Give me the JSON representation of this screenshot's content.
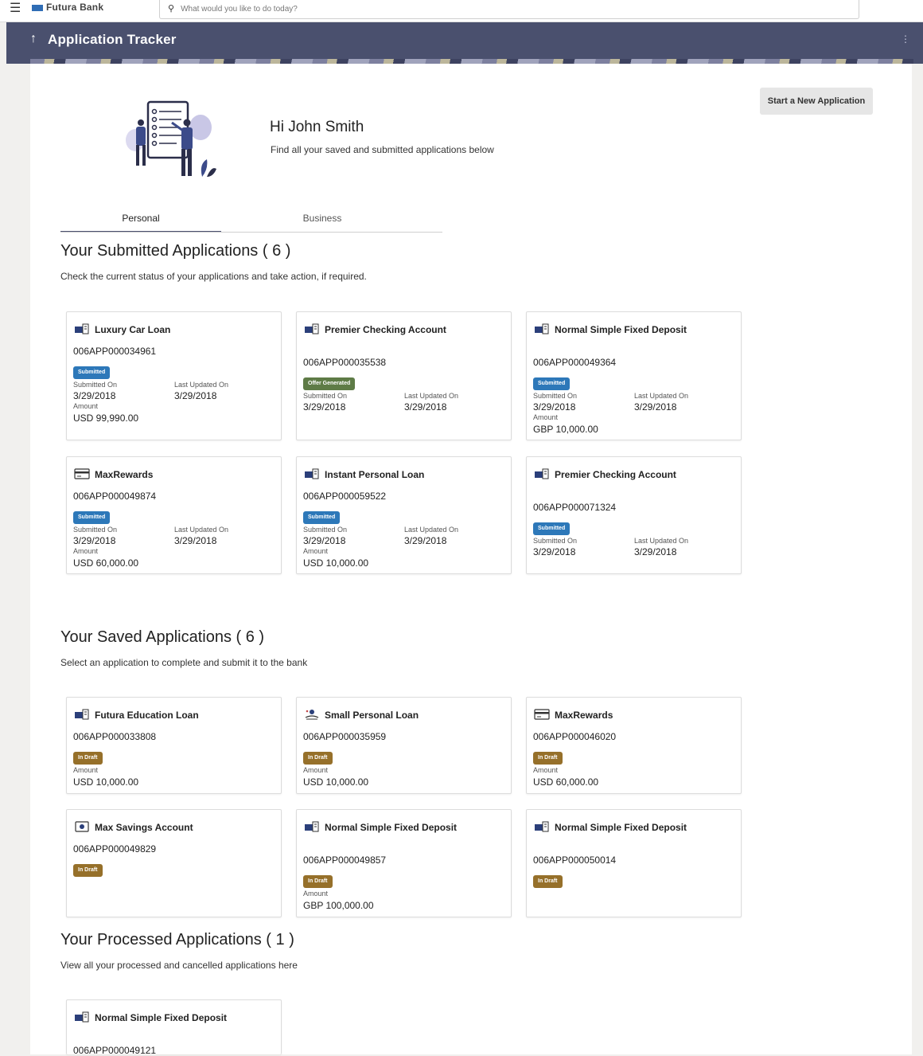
{
  "topbar": {
    "brand": "Futura Bank",
    "search_placeholder": "What would you like to do today?"
  },
  "header": {
    "title": "Application Tracker"
  },
  "actions": {
    "start_new": "Start a New Application"
  },
  "greeting": {
    "title": "Hi John Smith",
    "subtitle": "Find all your saved and submitted applications below"
  },
  "tabs": [
    {
      "label": "Personal"
    },
    {
      "label": "Business"
    }
  ],
  "submitted": {
    "title": "Your Submitted Applications ( 6 )",
    "subtitle": "Check the current status of your applications and take action, if required.",
    "cards": [
      {
        "name": "Luxury Car Loan",
        "ref": "006APP000034961",
        "status": "Submitted",
        "submitted_label": "Submitted On",
        "submitted_on": "3/29/2018",
        "updated_label": "Last Updated On",
        "updated_on": "3/29/2018",
        "amount_label": "Amount",
        "amount": "USD 99,990.00"
      },
      {
        "name": "Premier Checking Account",
        "ref": "006APP000035538",
        "status": "Offer Generated",
        "submitted_label": "Submitted On",
        "submitted_on": "3/29/2018",
        "updated_label": "Last Updated On",
        "updated_on": "3/29/2018"
      },
      {
        "name": "Normal Simple Fixed Deposit",
        "ref": "006APP000049364",
        "status": "Submitted",
        "submitted_label": "Submitted On",
        "submitted_on": "3/29/2018",
        "updated_label": "Last Updated On",
        "updated_on": "3/29/2018",
        "amount_label": "Amount",
        "amount": "GBP 10,000.00"
      },
      {
        "name": "MaxRewards",
        "ref": "006APP000049874",
        "status": "Submitted",
        "submitted_label": "Submitted On",
        "submitted_on": "3/29/2018",
        "updated_label": "Last Updated On",
        "updated_on": "3/29/2018",
        "amount_label": "Amount",
        "amount": "USD 60,000.00"
      },
      {
        "name": "Instant Personal Loan",
        "ref": "006APP000059522",
        "status": "Submitted",
        "submitted_label": "Submitted On",
        "submitted_on": "3/29/2018",
        "updated_label": "Last Updated On",
        "updated_on": "3/29/2018",
        "amount_label": "Amount",
        "amount": "USD 10,000.00"
      },
      {
        "name": "Premier Checking Account",
        "ref": "006APP000071324",
        "status": "Submitted",
        "submitted_label": "Submitted On",
        "submitted_on": "3/29/2018",
        "updated_label": "Last Updated On",
        "updated_on": "3/29/2018"
      }
    ]
  },
  "saved": {
    "title": "Your Saved Applications ( 6 )",
    "subtitle": "Select an application to complete and submit it to the bank",
    "cards": [
      {
        "name": "Futura Education Loan",
        "ref": "006APP000033808",
        "status": "In Draft",
        "amount_label": "Amount",
        "amount": "USD 10,000.00"
      },
      {
        "name": "Small Personal Loan",
        "ref": "006APP000035959",
        "status": "In Draft",
        "amount_label": "Amount",
        "amount": "USD 10,000.00"
      },
      {
        "name": "MaxRewards",
        "ref": "006APP000046020",
        "status": "In Draft",
        "amount_label": "Amount",
        "amount": "USD 60,000.00"
      },
      {
        "name": "Max Savings Account",
        "ref": "006APP000049829",
        "status": "In Draft"
      },
      {
        "name": "Normal Simple Fixed Deposit",
        "ref": "006APP000049857",
        "status": "In Draft",
        "amount_label": "Amount",
        "amount": "GBP 100,000.00"
      },
      {
        "name": "Normal Simple Fixed Deposit",
        "ref": "006APP000050014",
        "status": "In Draft"
      }
    ]
  },
  "processed": {
    "title": "Your Processed Applications ( 1 )",
    "subtitle": "View all your processed and cancelled applications here",
    "cards": [
      {
        "name": "Normal Simple Fixed Deposit",
        "ref": "006APP000049121"
      }
    ]
  }
}
